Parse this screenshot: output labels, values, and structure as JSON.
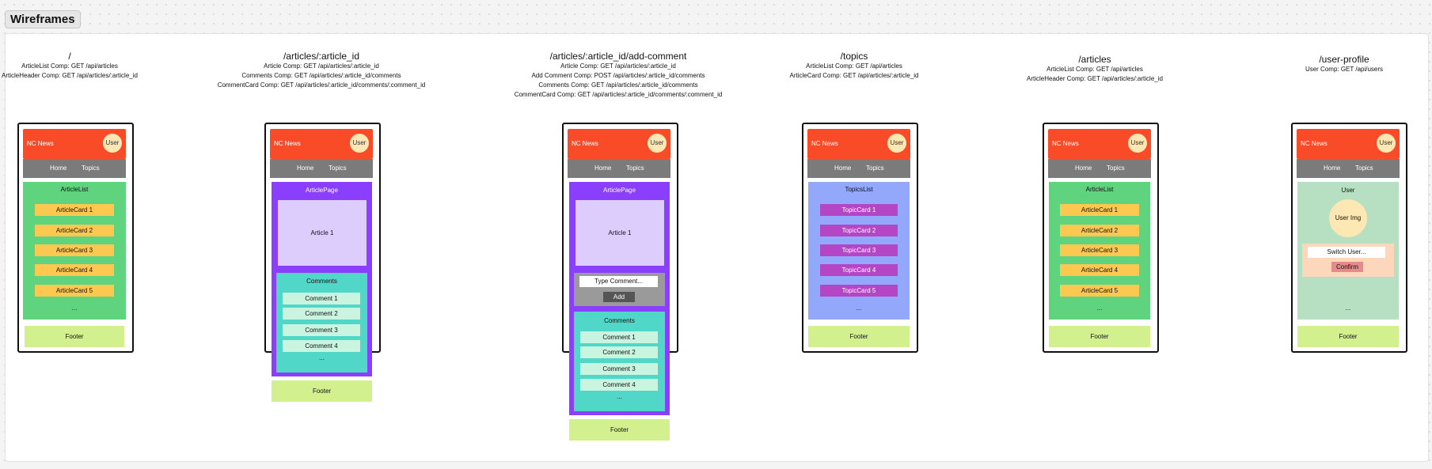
{
  "board_title": "Wireframes",
  "common": {
    "brand": "NC News",
    "user": "User",
    "home": "Home",
    "topics": "Topics",
    "footer": "Footer",
    "ellipsis": "..."
  },
  "columns": [
    {
      "route": "/",
      "apis": [
        "ArticleList Comp: GET /api/articles",
        "ArticleHeader Comp: GET /api/articles/:article_id"
      ],
      "panel_title": "ArticleList",
      "cards": [
        "ArticleCard 1",
        "ArticleCard 2",
        "ArticleCard 3",
        "ArticleCard 4",
        "ArticleCard 5"
      ]
    },
    {
      "route": "/articles/:article_id",
      "apis": [
        "Article Comp: GET /api/articles/:article_id",
        "Comments Comp: GET /api/articles/:article_id/comments",
        "CommentCard Comp: GET /api/articles/:article_id/comments/:comment_id"
      ],
      "panel_title": "ArticlePage",
      "article": "Article 1",
      "comments_title": "Comments",
      "comments": [
        "Comment 1",
        "Comment 2",
        "Comment 3",
        "Comment 4"
      ]
    },
    {
      "route": "/articles/:article_id/add-comment",
      "apis": [
        "Article Comp: GET /api/articles/:article_id",
        "Add Comment Comp: POST /api/articles/:article_id/comments",
        "Comments Comp: GET /api/articles/:article_id/comments",
        "CommentCard Comp: GET /api/articles/:article_id/comments/:comment_id"
      ],
      "panel_title": "ArticlePage",
      "article": "Article 1",
      "input_placeholder": "Type Comment...",
      "add_label": "Add",
      "comments_title": "Comments",
      "comments": [
        "Comment 1",
        "Comment 2",
        "Comment 3",
        "Comment 4"
      ]
    },
    {
      "route": "/topics",
      "apis": [
        "ArticleList Comp: GET /api/articles",
        "ArticleCard Comp: GET /api/articles/:article_id"
      ],
      "panel_title": "TopicsList",
      "cards": [
        "TopicCard 1",
        "TopicCard 2",
        "TopicCard 3",
        "TopicCard 4",
        "TopicCard 5"
      ]
    },
    {
      "route": "/articles",
      "apis": [
        "ArticleList Comp: GET /api/articles",
        "ArticleHeader Comp: GET /api/articles/:article_id"
      ],
      "panel_title": "ArticleList",
      "cards": [
        "ArticleCard 1",
        "ArticleCard 2",
        "ArticleCard 3",
        "ArticleCard 4",
        "ArticleCard 5"
      ]
    },
    {
      "route": "/user-profile",
      "apis": [
        "User Comp: GET /api/users"
      ],
      "panel_title": "User",
      "avatar": "User Img",
      "switch_label": "Switch User...",
      "confirm_label": "Confirm"
    }
  ]
}
